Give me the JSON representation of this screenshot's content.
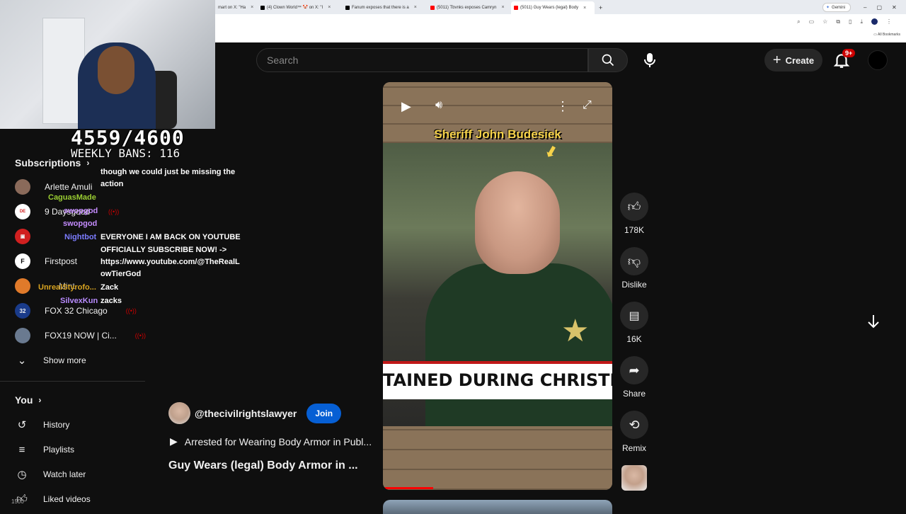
{
  "browser": {
    "tabs": [
      {
        "label": "mart on X: \"Ha",
        "color": "#000000"
      },
      {
        "label": "(4) Clown World™ 🤡 on X: \"I",
        "color": "#000000"
      },
      {
        "label": "Fanum exposes that there is a",
        "color": "#000000"
      },
      {
        "label": "(5011) Tbvnks exposes Camryn",
        "color": "#ff0000"
      },
      {
        "label": "(5011) Guy Wears (legal) Body",
        "color": "#ff0000"
      }
    ],
    "gemini": "Gemini",
    "bookmarks": "All Bookmarks"
  },
  "overlay": {
    "counter": "4559/4600",
    "weekly_bans": "WEEKLY BANS: 116"
  },
  "chat": [
    {
      "user": "",
      "text": "though we could just be missing the",
      "user_color": "#ffffff"
    },
    {
      "user": "",
      "text": "action",
      "user_color": "#ffffff"
    },
    {
      "user": "CaguasMade",
      "text": "",
      "user_color": "#9acd32"
    },
    {
      "user": "swopgod",
      "text": "",
      "user_color": "#c58cff"
    },
    {
      "user": "swopgod",
      "text": "",
      "user_color": "#c58cff"
    },
    {
      "user": "Nightbot",
      "text": "EVERYONE I AM BACK ON YOUTUBE",
      "user_color": "#7c7cff"
    },
    {
      "user": "",
      "text": "OFFICIALLY SUBSCRIBE NOW! ->",
      "user_color": "#ffffff"
    },
    {
      "user": "",
      "text": "https://www.youtube.com/@TheRealL",
      "user_color": "#ffffff"
    },
    {
      "user": "",
      "text": "owTierGod",
      "user_color": "#ffffff"
    },
    {
      "user": "UnrealStyrofo...",
      "text": "Zack",
      "user_color": "#daa520"
    },
    {
      "user": "SilvexKun",
      "text": "zacks",
      "user_color": "#b98cff"
    }
  ],
  "sidebar": {
    "subscriptions_label": "Subscriptions",
    "channels": [
      {
        "name": "Arlette Amuli",
        "initial": "",
        "color": "#8a6a5a",
        "live": false
      },
      {
        "name": "9 Daysgood",
        "initial": "",
        "color": "#d02020",
        "live": true
      },
      {
        "name": "Nightbot",
        "initial": "",
        "color": "#d02020",
        "live": false
      },
      {
        "name": "Firstpost",
        "initial": "F",
        "color": "#ffffff",
        "live": false
      },
      {
        "name": "Mint",
        "initial": "",
        "color": "#e07a2a",
        "live": false
      },
      {
        "name": "FOX 32 Chicago",
        "initial": "32",
        "color": "#1a3b8a",
        "live": true
      },
      {
        "name": "FOX19 NOW | Ci...",
        "initial": "",
        "color": "#6a7a90",
        "live": true
      }
    ],
    "show_more": "Show more",
    "you_label": "You",
    "you_items": [
      "History",
      "Playlists",
      "Watch later",
      "Liked videos"
    ],
    "corner_badge": "1500"
  },
  "header": {
    "search_placeholder": "Search",
    "create_label": "Create",
    "notif_count": "9+"
  },
  "video": {
    "overlay_name": "Sheriff John Budesiek",
    "chyron": "TAINED DURING CHRISTMAS PARA",
    "progress": 0.22
  },
  "actions": {
    "likes": "178K",
    "dislike": "Dislike",
    "comments": "16K",
    "share": "Share",
    "remix": "Remix"
  },
  "channel": {
    "handle": "@thecivilrightslawyer",
    "join": "Join",
    "playlist_title": "Arrested for Wearing Body Armor in Publ...",
    "video_title": "Guy Wears (legal) Body Armor in ..."
  },
  "colors": {
    "accent": "#065fd4",
    "live": "#cc0000",
    "chyron_red": "#c01818",
    "overlay_yellow": "#f6d24a"
  }
}
